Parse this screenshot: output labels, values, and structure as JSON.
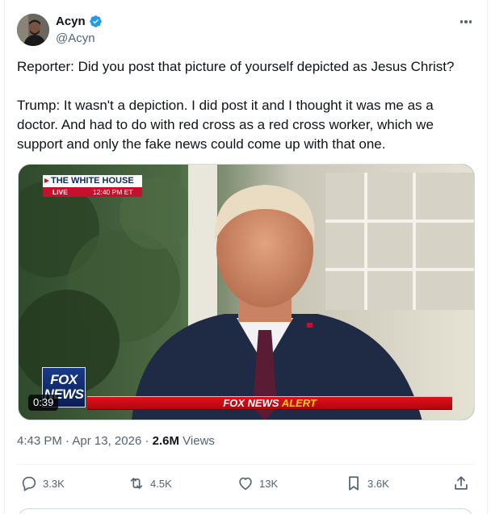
{
  "author": {
    "display_name": "Acyn",
    "handle": "@Acyn",
    "avatar_icon": "avatar-photo",
    "verified_icon": "verified-badge-icon",
    "verified_color": "#1d9bf0"
  },
  "tweet": {
    "paragraphs": [
      "Reporter: Did you post that picture of yourself depicted as Jesus Christ?",
      "Trump: It wasn't a depiction. I did post it and I thought it was me as a doctor. And had to do with red cross as a red cross worker, which we support and only the fake news could come up with that one."
    ]
  },
  "media": {
    "type": "video",
    "duration": "0:39",
    "overlay": {
      "location": "THE WHITE HOUSE",
      "live": "LIVE",
      "time": "12:40 PM ET",
      "network_logo_line1": "FOX",
      "network_logo_line2": "NEWS",
      "alert_network": "FOX NEWS",
      "alert_word": "ALERT"
    }
  },
  "meta": {
    "time": "4:43 PM",
    "separator": "·",
    "date": "Apr 13, 2026",
    "views_count": "2.6M",
    "views_label": "Views"
  },
  "actions": {
    "reply": {
      "icon": "reply-icon",
      "count": "3.3K"
    },
    "repost": {
      "icon": "repost-icon",
      "count": "4.5K"
    },
    "like": {
      "icon": "heart-icon",
      "count": "13K"
    },
    "bookmark": {
      "icon": "bookmark-icon",
      "count": "3.6K"
    },
    "share": {
      "icon": "share-icon"
    }
  },
  "colors": {
    "text_primary": "#0f1419",
    "text_secondary": "#536471",
    "divider": "#eff3f4",
    "fox_red": "#c8102e",
    "alert_yellow": "#ffd400"
  }
}
